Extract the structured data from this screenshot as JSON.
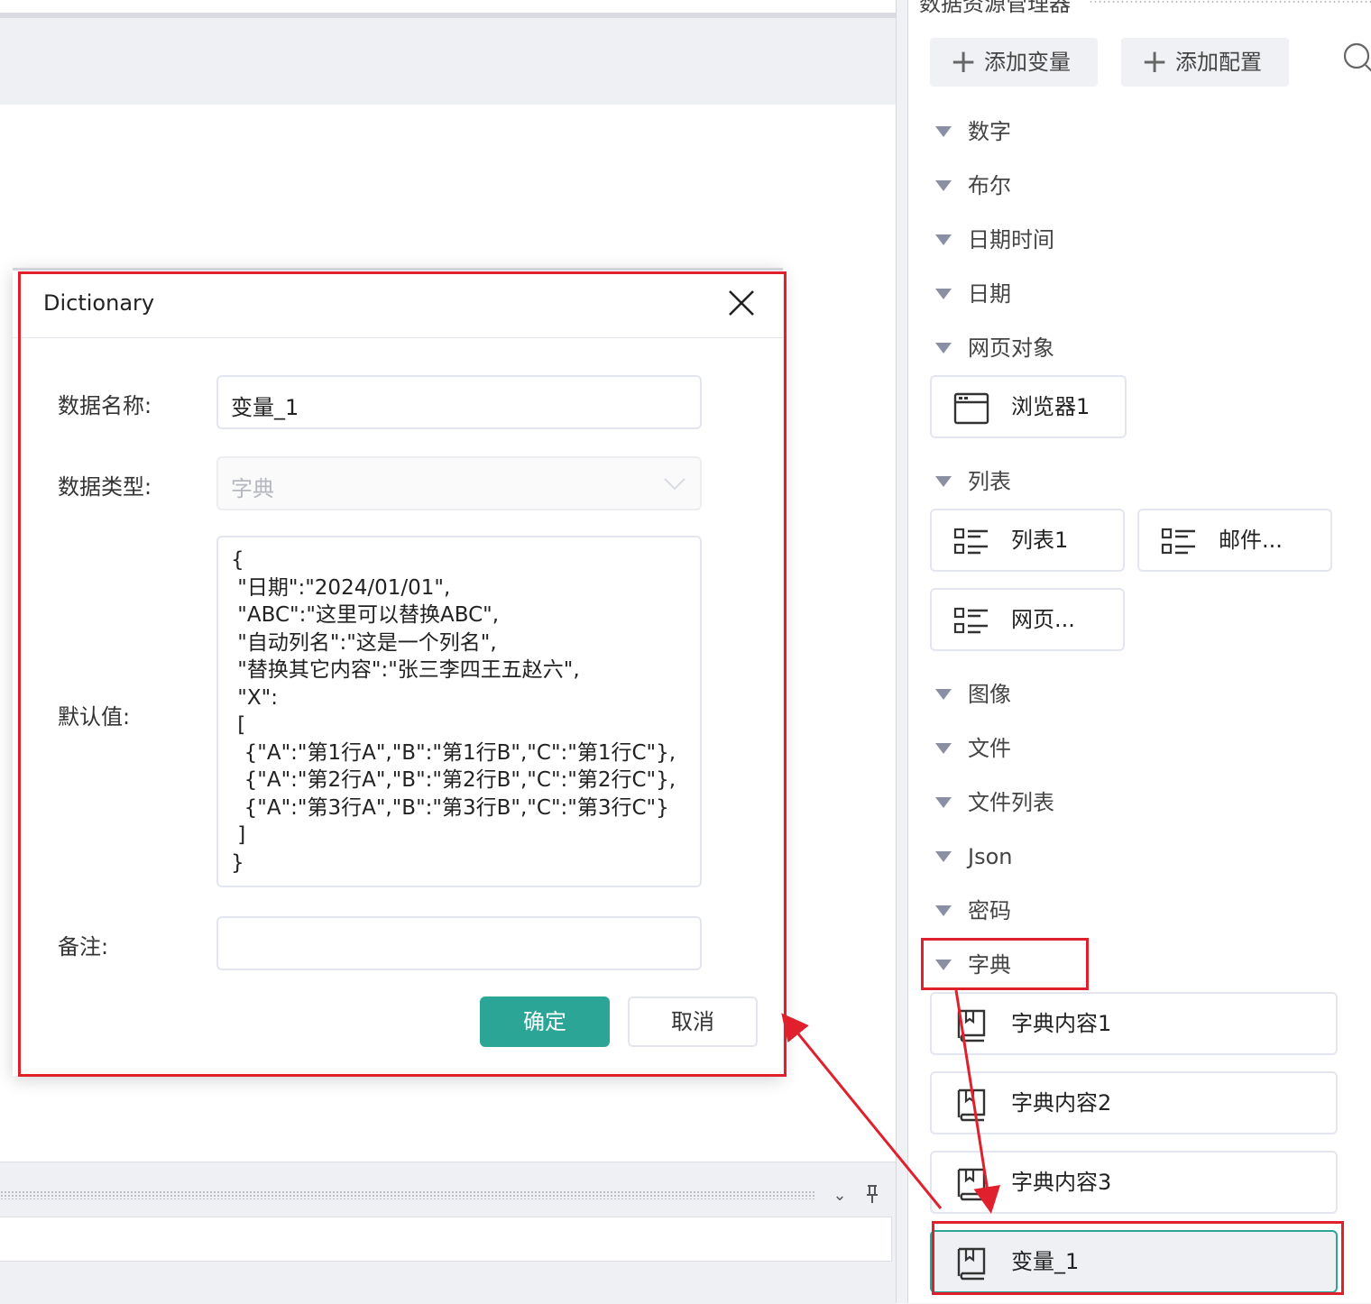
{
  "dialog": {
    "title": "Dictionary",
    "name_label": "数据名称:",
    "name_value": "变量_1",
    "type_label": "数据类型:",
    "type_value": "字典",
    "default_label": "默认值:",
    "default_value": "{\n \"日期\":\"2024/01/01\",\n \"ABC\":\"这里可以替换ABC\",\n \"自动列名\":\"这是一个列名\",\n \"替换其它内容\":\"张三李四王五赵六\",\n \"X\":\n [\n  {\"A\":\"第1行A\",\"B\":\"第1行B\",\"C\":\"第1行C\"},\n  {\"A\":\"第2行A\",\"B\":\"第2行B\",\"C\":\"第2行C\"},\n  {\"A\":\"第3行A\",\"B\":\"第3行B\",\"C\":\"第3行C\"}\n ]\n}",
    "remark_label": "备注:",
    "remark_value": "",
    "ok_label": "确定",
    "cancel_label": "取消"
  },
  "panel": {
    "title": "数据资源管理器",
    "add_variable": "添加变量",
    "add_config": "添加配置",
    "categories": {
      "number": "数字",
      "bool": "布尔",
      "datetime": "日期时间",
      "date": "日期",
      "webobj": "网页对象",
      "list": "列表",
      "image": "图像",
      "file": "文件",
      "filelist": "文件列表",
      "json": "Json",
      "password": "密码",
      "dict": "字典"
    },
    "items": {
      "browser1": "浏览器1",
      "list1": "列表1",
      "mail": "邮件...",
      "webpage": "网页...",
      "dict1": "字典内容1",
      "dict2": "字典内容2",
      "dict3": "字典内容3",
      "var1": "变量_1"
    }
  },
  "colors": {
    "primary": "#2ba595",
    "annotation": "#e0202c"
  }
}
